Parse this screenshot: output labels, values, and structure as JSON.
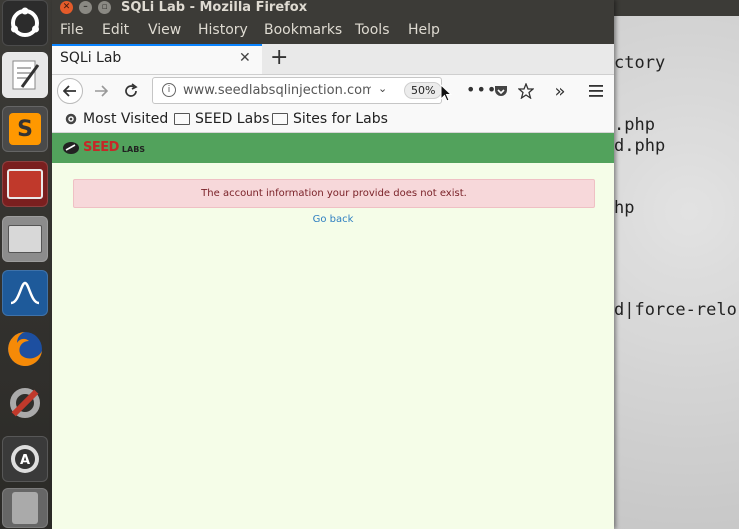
{
  "window": {
    "title": "SQLi Lab - Mozilla Firefox"
  },
  "menubar": {
    "file": "File",
    "edit": "Edit",
    "view": "View",
    "history": "History",
    "bookmarks": "Bookmarks",
    "tools": "Tools",
    "help": "Help"
  },
  "tab": {
    "title": "SQLi Lab",
    "new_tab_symbol": "+"
  },
  "urlbar": {
    "url": "www.seedlabsqlinjection.com",
    "zoom": "50%"
  },
  "bookmarks_toolbar": {
    "items": [
      "Most Visited",
      "SEED Labs",
      "Sites for Labs"
    ]
  },
  "page": {
    "logo_text_main": "SEED",
    "logo_text_sub": "LABS",
    "alert_message": "The account information your provide does not exist.",
    "go_back_link": "Go back"
  },
  "terminal": {
    "lines": [
      "ctory",
      ".php",
      "d.php",
      "hp",
      "d|force-relo"
    ]
  },
  "colors": {
    "page_header": "#52a25c",
    "page_background": "#f5fde8",
    "alert_background": "#f7d8da",
    "alert_text": "#7a2228",
    "link": "#2f7fc1",
    "tab_accent": "#0a84ff"
  }
}
